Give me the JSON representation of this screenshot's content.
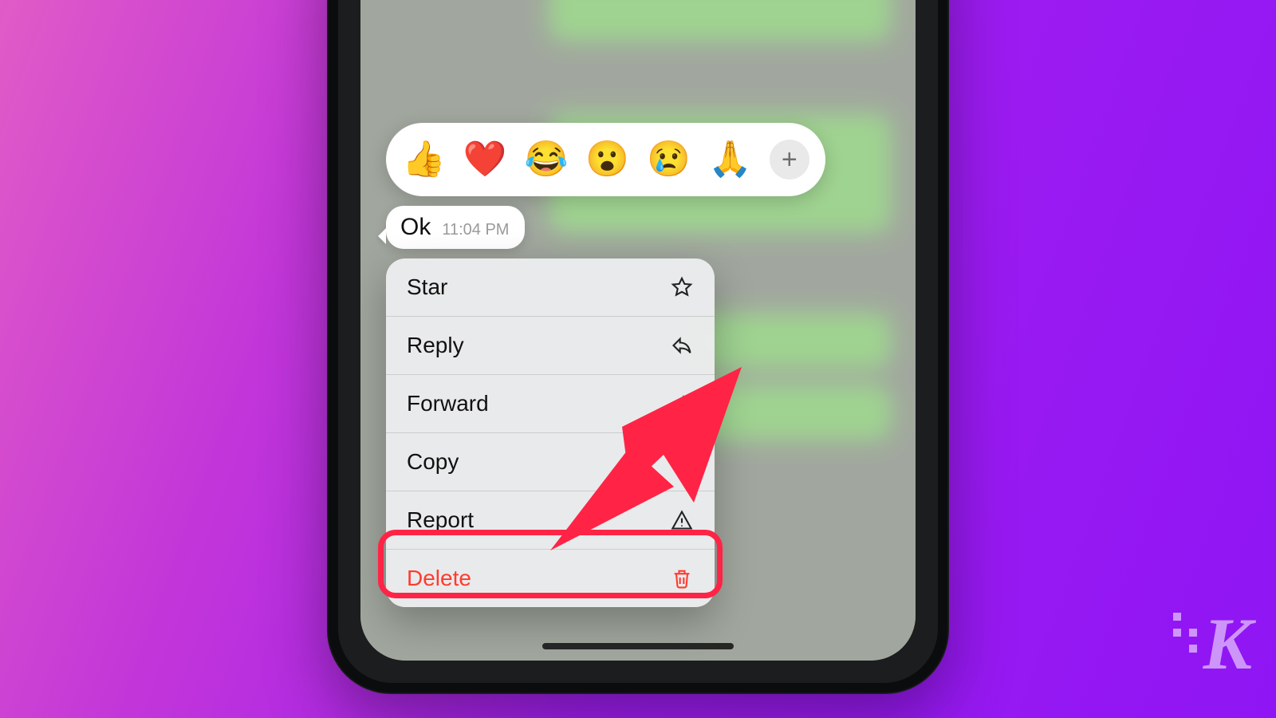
{
  "reactions": [
    "👍",
    "❤️",
    "😂",
    "😮",
    "😢",
    "🙏"
  ],
  "reaction_more_label": "+",
  "message": {
    "text": "Ok",
    "time": "11:04 PM"
  },
  "menu": {
    "items": [
      {
        "label": "Star",
        "icon": "star-icon",
        "destructive": false
      },
      {
        "label": "Reply",
        "icon": "reply-icon",
        "destructive": false
      },
      {
        "label": "Forward",
        "icon": "forward-icon",
        "destructive": false
      },
      {
        "label": "Copy",
        "icon": "copy-icon",
        "destructive": false
      },
      {
        "label": "Report",
        "icon": "report-icon",
        "destructive": false
      },
      {
        "label": "Delete",
        "icon": "trash-icon",
        "destructive": true
      }
    ]
  },
  "watermark": "K",
  "colors": {
    "destructive": "#ff3b30",
    "highlight": "#ff2446"
  }
}
